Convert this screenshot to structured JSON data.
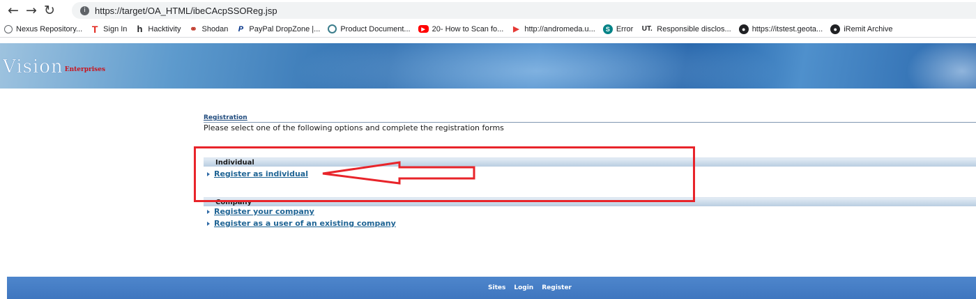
{
  "browser": {
    "url": "https://target/OA_HTML/ibeCAcpSSOReg.jsp",
    "bookmarks": [
      {
        "label": "Nexus Repository...",
        "icon": "cube-icon",
        "color": "#5f6368"
      },
      {
        "label": "Sign In",
        "icon": "t-logo-icon",
        "color": "#e2231a"
      },
      {
        "label": "Hacktivity",
        "icon": "h1-logo-icon",
        "color": "#202124"
      },
      {
        "label": "Shodan",
        "icon": "shodan-icon",
        "color": "#c0392b"
      },
      {
        "label": "PayPal DropZone |...",
        "icon": "paypal-icon",
        "color": "#003087"
      },
      {
        "label": "Product Document...",
        "icon": "circle-logo-icon",
        "color": "#3b7d8c"
      },
      {
        "label": "20- How to Scan fo...",
        "icon": "youtube-icon",
        "color": "#ff0000"
      },
      {
        "label": "http://andromeda.u...",
        "icon": "play-arrow-icon",
        "color": "#e53935"
      },
      {
        "label": "Error",
        "icon": "sharepoint-icon",
        "color": "#038387"
      },
      {
        "label": "Responsible disclos...",
        "icon": "ut-logo-icon",
        "color": "#202124"
      },
      {
        "label": "https://itstest.geota...",
        "icon": "globe-icon",
        "color": "#202124"
      },
      {
        "label": "iRemit Archive",
        "icon": "globe-icon",
        "color": "#202124"
      }
    ]
  },
  "banner": {
    "logo_main": "Vision",
    "logo_sub": "Enterprises"
  },
  "registration": {
    "title": "Registration",
    "subtitle": "Please select one of the following options and complete the registration forms"
  },
  "sections": {
    "individual": {
      "header": "Individual",
      "links": [
        "Register as individual"
      ]
    },
    "company": {
      "header": "Company",
      "links": [
        "Register your company",
        "Register as a user of an existing company"
      ]
    }
  },
  "footer": {
    "links": [
      "Sites",
      "Login",
      "Register"
    ]
  },
  "colors": {
    "annotation": "#e8242a",
    "link": "#1f6494",
    "footer": "#3f76bf"
  }
}
